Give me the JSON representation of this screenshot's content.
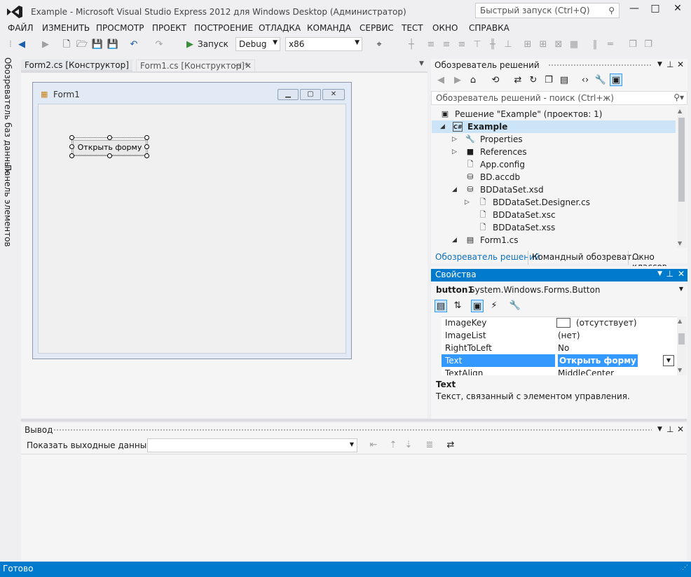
{
  "window": {
    "title": "Example - Microsoft Visual Studio Express 2012 для Windows Desktop (Администратор)",
    "quick_launch_placeholder": "Быстрый запуск (Ctrl+Q)",
    "minimize": "—",
    "maximize": "□",
    "close": "✕"
  },
  "menu": [
    "ФАЙЛ",
    "ИЗМЕНИТЬ",
    "ПРОСМОТР",
    "ПРОЕКТ",
    "ПОСТРОЕНИЕ",
    "ОТЛАДКА",
    "КОМАНДА",
    "СЕРВИС",
    "ТЕСТ",
    "ОКНО",
    "СПРАВКА"
  ],
  "toolbar": {
    "start_label": "Запуск",
    "config": "Debug",
    "platform": "x86"
  },
  "sidebar": {
    "db_explorer": "Обозреватель баз данных",
    "toolbox": "Панель элементов"
  },
  "editor": {
    "tabs": [
      "Form2.cs [Конструктор]",
      "Form1.cs [Конструктор]*"
    ],
    "form_title": "Form1",
    "button_text": "Открыть форму"
  },
  "solution_explorer": {
    "title": "Обозреватель решений",
    "search_placeholder": "Обозреватель решений - поиск (Ctrl+ж)",
    "items": [
      {
        "label": "Решение \"Example\"  (проектов: 1)",
        "icon": "solution-icon"
      },
      {
        "label": "Example",
        "icon": "csharp-project-icon"
      },
      {
        "label": "Properties",
        "icon": "wrench-icon"
      },
      {
        "label": "References",
        "icon": "references-icon"
      },
      {
        "label": "App.config",
        "icon": "config-file-icon"
      },
      {
        "label": "BD.accdb",
        "icon": "database-icon"
      },
      {
        "label": "BDDataSet.xsd",
        "icon": "dataset-icon"
      },
      {
        "label": "BDDataSet.Designer.cs",
        "icon": "cs-file-icon"
      },
      {
        "label": "BDDataSet.xsc",
        "icon": "file-icon"
      },
      {
        "label": "BDDataSet.xss",
        "icon": "file-icon"
      },
      {
        "label": "Form1.cs",
        "icon": "form-file-icon"
      }
    ],
    "bottom_tabs": [
      "Обозреватель решений",
      "Командный обозреват...",
      "Окно классов"
    ]
  },
  "properties": {
    "title": "Свойства",
    "object": "button1",
    "object_type": "System.Windows.Forms.Button",
    "rows": [
      {
        "name": "ImageKey",
        "value": "(отсутствует)"
      },
      {
        "name": "ImageList",
        "value": "(нет)"
      },
      {
        "name": "RightToLeft",
        "value": "No"
      },
      {
        "name": "Text",
        "value": "Открыть форму"
      },
      {
        "name": "TextAlign",
        "value": "MiddleCenter"
      }
    ],
    "desc_title": "Text",
    "desc_text": "Текст, связанный с элементом управления."
  },
  "output": {
    "title": "Вывод",
    "show_from_label": "Показать выходные данные от:"
  },
  "status": {
    "text": "Готово"
  },
  "colors": {
    "accent": "#007acc",
    "background": "#efeff2"
  }
}
